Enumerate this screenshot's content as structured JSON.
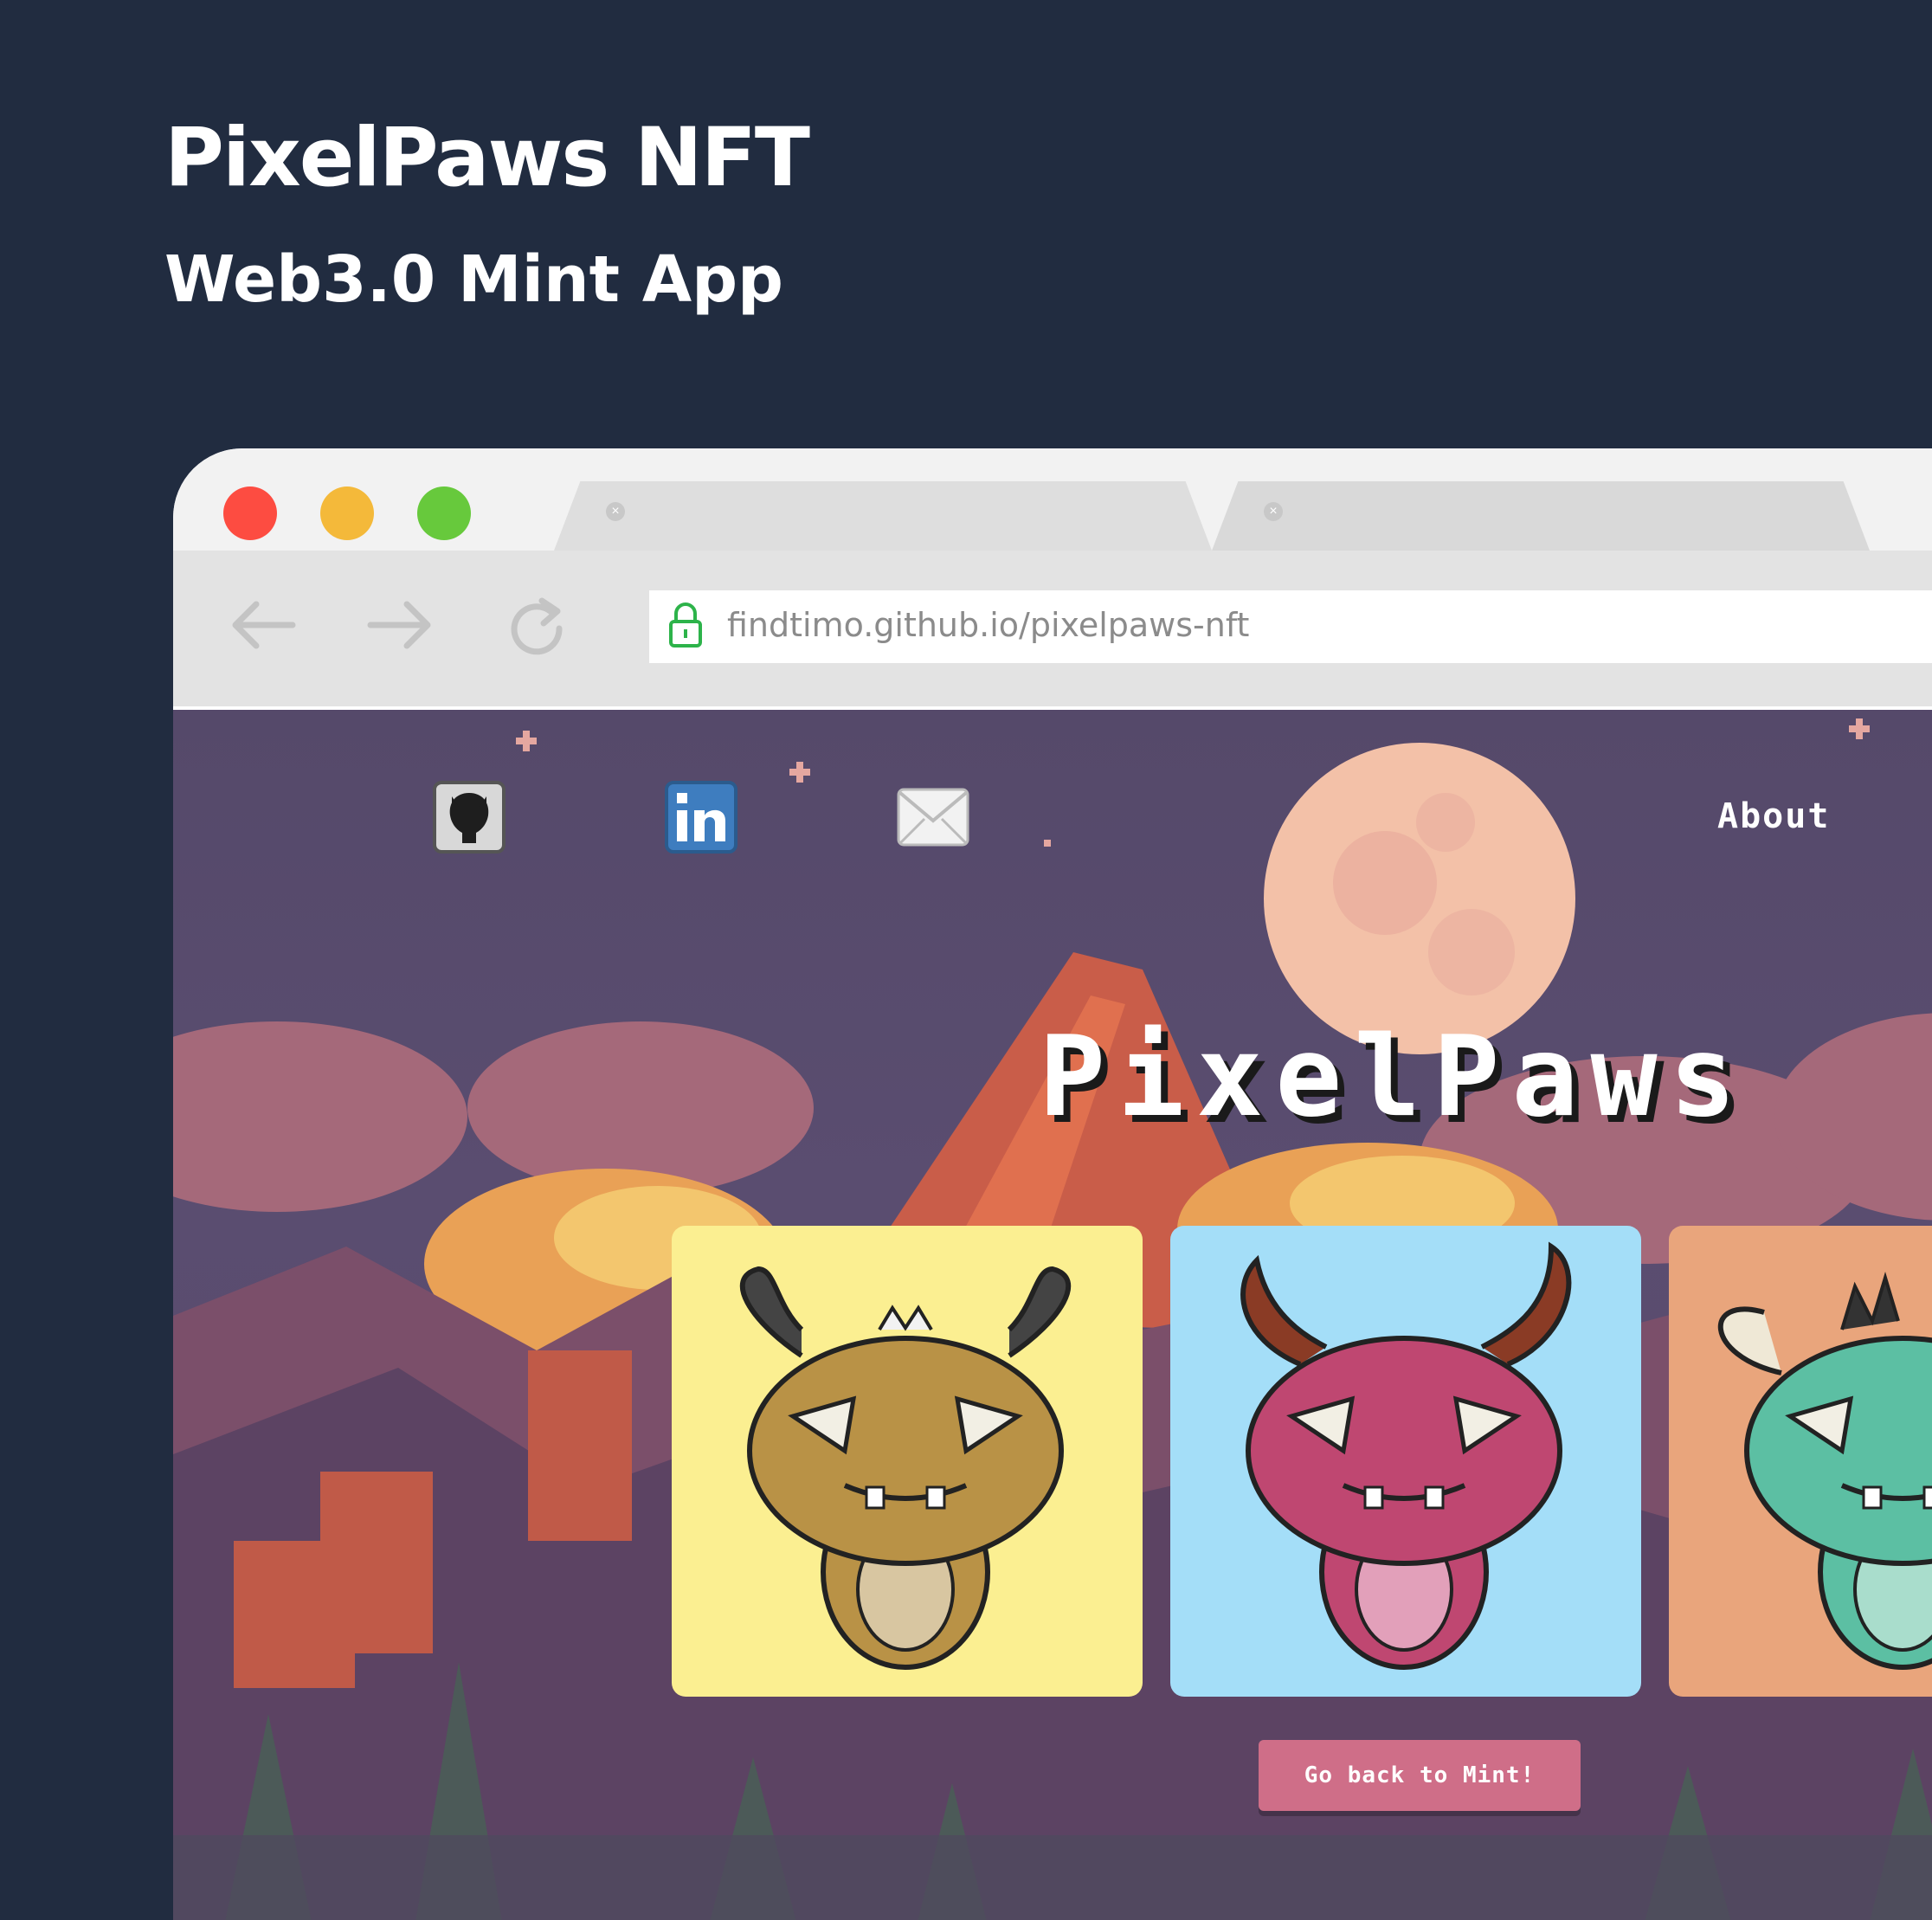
{
  "promo": {
    "title": "PixelPaws NFT",
    "subtitle": "Web3.0 Mint App"
  },
  "browser": {
    "url": "findtimo.github.io/pixelpaws-nft",
    "tabs": [
      {
        "label": ""
      },
      {
        "label": ""
      }
    ],
    "window_controls": {
      "close_color": "#fd4c41",
      "minimize_color": "#f4b93a",
      "maximize_color": "#67c93c"
    }
  },
  "site": {
    "nav": {
      "about_label": "About",
      "social": [
        "github-icon",
        "linkedin-icon",
        "mail-icon"
      ]
    },
    "hero_title": "PixelPaws",
    "cards": [
      {
        "background": "#fbef91",
        "creature_color": "#b99246"
      },
      {
        "background": "#a4def8",
        "creature_color": "#bf4771"
      },
      {
        "background": "#e9a57c",
        "creature_color": "#5cbfa3"
      }
    ],
    "mint_button_label": "Go back to Mint!"
  },
  "colors": {
    "page_background": "#212c40",
    "accent": "#cf6e88"
  }
}
